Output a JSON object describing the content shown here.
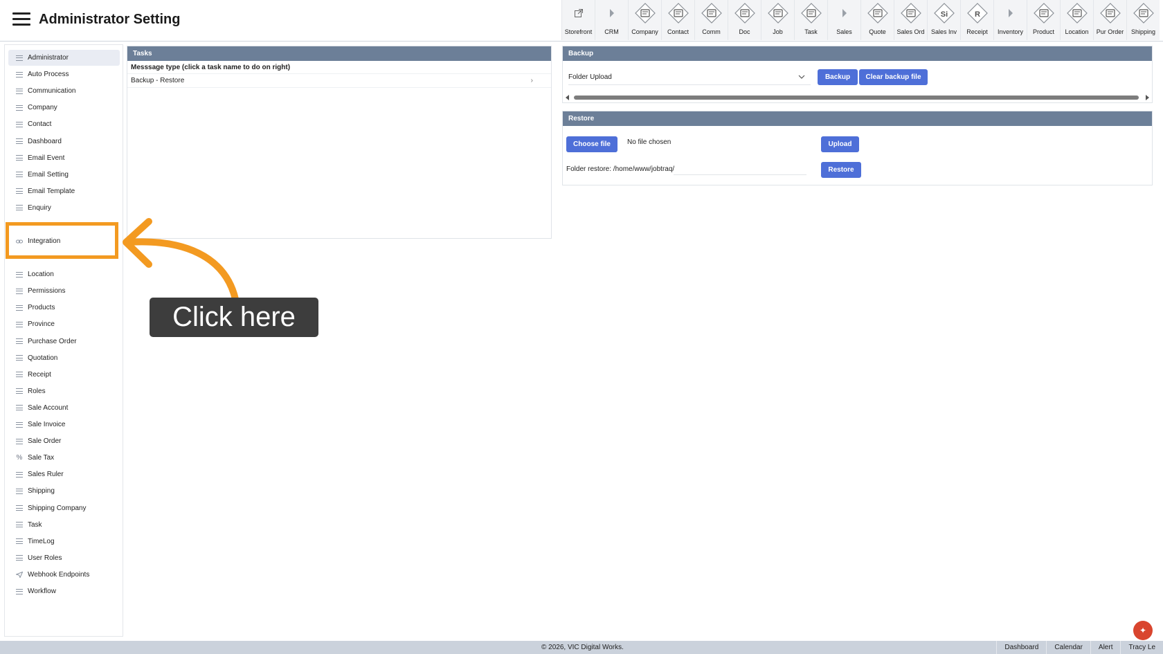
{
  "header": {
    "title": "Administrator Setting"
  },
  "toolbar": [
    {
      "label": "Storefront",
      "icon": "external-link-icon"
    },
    {
      "label": "CRM",
      "icon": "caret-right-icon"
    },
    {
      "label": "Company",
      "icon": "company-icon"
    },
    {
      "label": "Contact",
      "icon": "contact-icon"
    },
    {
      "label": "Comm",
      "icon": "globe-icon"
    },
    {
      "label": "Doc",
      "icon": "doc-icon"
    },
    {
      "label": "Job",
      "icon": "job-icon"
    },
    {
      "label": "Task",
      "icon": "task-icon"
    },
    {
      "label": "Sales",
      "icon": "caret-right-icon"
    },
    {
      "label": "Quote",
      "icon": "quote-icon"
    },
    {
      "label": "Sales Ord",
      "icon": "sales-order-icon"
    },
    {
      "label": "Sales Inv",
      "icon": "sales-invoice-icon",
      "glyph": "Si"
    },
    {
      "label": "Receipt",
      "icon": "receipt-icon",
      "glyph": "R"
    },
    {
      "label": "Inventory",
      "icon": "caret-right-icon"
    },
    {
      "label": "Product",
      "icon": "product-icon"
    },
    {
      "label": "Location",
      "icon": "location-icon"
    },
    {
      "label": "Pur Order",
      "icon": "cart-icon"
    },
    {
      "label": "Shipping",
      "icon": "truck-icon"
    }
  ],
  "sidebar": {
    "items": [
      {
        "label": "Administrator",
        "active": true
      },
      {
        "label": "Auto Process"
      },
      {
        "label": "Communication"
      },
      {
        "label": "Company"
      },
      {
        "label": "Contact"
      },
      {
        "label": "Dashboard"
      },
      {
        "label": "Email Event"
      },
      {
        "label": "Email Setting"
      },
      {
        "label": "Email Template"
      },
      {
        "label": "Enquiry"
      },
      {
        "label": "Integration",
        "icon": "link-icon"
      },
      {
        "label": "Location"
      },
      {
        "label": "Permissions"
      },
      {
        "label": "Products"
      },
      {
        "label": "Province"
      },
      {
        "label": "Purchase Order"
      },
      {
        "label": "Quotation"
      },
      {
        "label": "Receipt"
      },
      {
        "label": "Roles"
      },
      {
        "label": "Sale Account"
      },
      {
        "label": "Sale Invoice"
      },
      {
        "label": "Sale Order"
      },
      {
        "label": "Sale Tax",
        "icon": "percent-icon"
      },
      {
        "label": "Sales Ruler"
      },
      {
        "label": "Shipping"
      },
      {
        "label": "Shipping Company"
      },
      {
        "label": "Task"
      },
      {
        "label": "TimeLog"
      },
      {
        "label": "User Roles"
      },
      {
        "label": "Webhook Endpoints",
        "icon": "send-icon"
      },
      {
        "label": "Workflow"
      }
    ]
  },
  "tasks": {
    "title": "Tasks",
    "header": "Messsage type (click a task name to do on right)",
    "rows": [
      "Backup - Restore"
    ]
  },
  "backup": {
    "title": "Backup",
    "select_value": "Folder Upload",
    "backup_button": "Backup",
    "clear_button": "Clear backup file"
  },
  "restore": {
    "title": "Restore",
    "choose_file_button": "Choose file",
    "file_status": "No file chosen",
    "upload_button": "Upload",
    "folder_label": "Folder restore: /home/www/jobtraq/",
    "restore_button": "Restore"
  },
  "annotation": {
    "callout": "Click here",
    "color": "#f39a21"
  },
  "footer": {
    "copyright": "© 2026, VIC Digital Works.",
    "links": [
      "Dashboard",
      "Calendar",
      "Alert",
      "Tracy Le"
    ]
  }
}
